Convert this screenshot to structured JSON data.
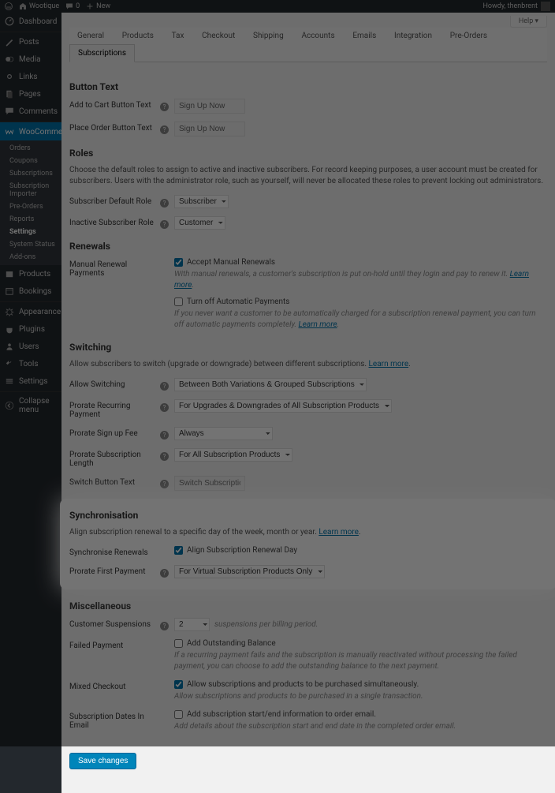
{
  "adminbar": {
    "site": "Wootique",
    "comments": "0",
    "new": "New",
    "howdy": "Howdy, thenbrent"
  },
  "sidebar": {
    "dashboard": "Dashboard",
    "posts": "Posts",
    "media": "Media",
    "links": "Links",
    "pages": "Pages",
    "comments": "Comments",
    "woocommerce": "WooCommerce",
    "wc_sub": {
      "orders": "Orders",
      "coupons": "Coupons",
      "subscriptions": "Subscriptions",
      "importer": "Subscription Importer",
      "preorders": "Pre-Orders",
      "reports": "Reports",
      "settings": "Settings",
      "status": "System Status",
      "addons": "Add-ons"
    },
    "products": "Products",
    "bookings": "Bookings",
    "appearance": "Appearance",
    "plugins": "Plugins",
    "users": "Users",
    "tools": "Tools",
    "settings": "Settings",
    "collapse": "Collapse menu"
  },
  "help": "Help",
  "tabs": {
    "general": "General",
    "products": "Products",
    "tax": "Tax",
    "checkout": "Checkout",
    "shipping": "Shipping",
    "accounts": "Accounts",
    "emails": "Emails",
    "integration": "Integration",
    "preorders": "Pre-Orders",
    "subscriptions": "Subscriptions"
  },
  "button_text": {
    "heading": "Button Text",
    "add_to_cart": {
      "label": "Add to Cart Button Text",
      "value": "Sign Up Now"
    },
    "place_order": {
      "label": "Place Order Button Text",
      "value": "Sign Up Now"
    }
  },
  "roles": {
    "heading": "Roles",
    "desc": "Choose the default roles to assign to active and inactive subscribers. For record keeping purposes, a user account must be created for subscribers. Users with the administrator role, such as yourself, will never be allocated these roles to prevent locking out administrators.",
    "default": {
      "label": "Subscriber Default Role",
      "value": "Subscriber"
    },
    "inactive": {
      "label": "Inactive Subscriber Role",
      "value": "Customer"
    }
  },
  "renewals": {
    "heading": "Renewals",
    "label": "Manual Renewal Payments",
    "accept": "Accept Manual Renewals",
    "accept_note": "With manual renewals, a customer's subscription is put on-hold until they login and pay to renew it. ",
    "learn_more": "Learn more",
    "turn_off": "Turn off Automatic Payments",
    "turn_off_note": "If you never want a customer to be automatically charged for a subscription renewal payment, you can turn off automatic payments completely. "
  },
  "switching": {
    "heading": "Switching",
    "desc": "Allow subscribers to switch (upgrade or downgrade) between different subscriptions. ",
    "learn_more": "Learn more",
    "allow": {
      "label": "Allow Switching",
      "value": "Between Both Variations & Grouped Subscriptions"
    },
    "prorate_recurring": {
      "label": "Prorate Recurring Payment",
      "value": "For Upgrades & Downgrades of All Subscription Products"
    },
    "prorate_signup": {
      "label": "Prorate Sign up Fee",
      "value": "Always"
    },
    "prorate_length": {
      "label": "Prorate Subscription Length",
      "value": "For All Subscription Products"
    },
    "switch_text": {
      "label": "Switch Button Text",
      "value": "Switch Subscription"
    }
  },
  "sync": {
    "heading": "Synchronisation",
    "desc": "Align subscription renewal to a specific day of the week, month or year. ",
    "learn_more": "Learn more",
    "renewals": {
      "label": "Synchronise Renewals",
      "check": "Align Subscription Renewal Day"
    },
    "prorate_first": {
      "label": "Prorate First Payment",
      "value": "For Virtual Subscription Products Only"
    }
  },
  "misc": {
    "heading": "Miscellaneous",
    "suspensions": {
      "label": "Customer Suspensions",
      "value": "2",
      "note": "suspensions per billing period."
    },
    "failed": {
      "label": "Failed Payment",
      "check": "Add Outstanding Balance",
      "note": "If a recurring payment fails and the subscription is manually reactivated without processing the failed payment, you can choose to add the outstanding balance to the next payment."
    },
    "mixed": {
      "label": "Mixed Checkout",
      "check": "Allow subscriptions and products to be purchased simultaneously.",
      "note": "Allow subscriptions and products to be purchased in a single transaction."
    },
    "dates": {
      "label": "Subscription Dates In Email",
      "check": "Add subscription start/end information to order email.",
      "note": "Add details about the subscription start and end date in the completed order email."
    }
  },
  "save": "Save changes"
}
